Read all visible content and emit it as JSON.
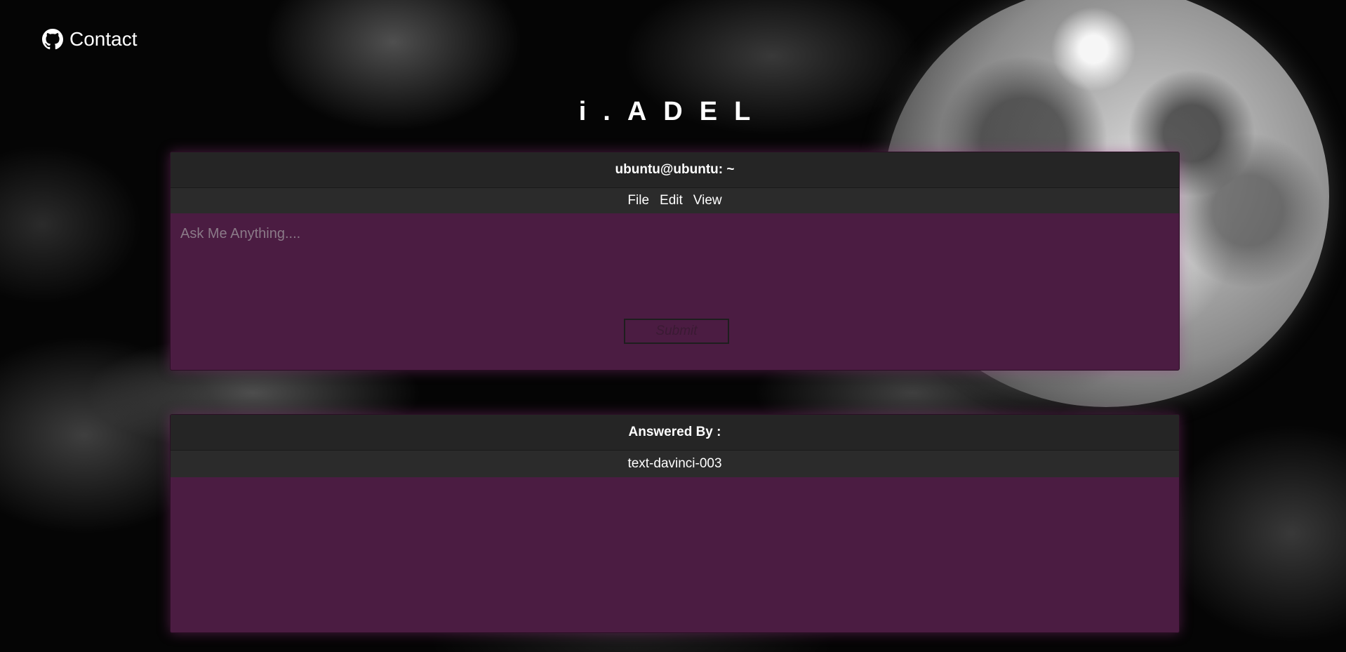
{
  "contact": {
    "label": "Contact",
    "icon": "github-icon"
  },
  "site": {
    "title": "i.ADEL"
  },
  "ask_panel": {
    "title": "ubuntu@ubuntu: ~",
    "menu": {
      "file": "File",
      "edit": "Edit",
      "view": "View"
    },
    "input_placeholder": "Ask Me Anything....",
    "submit_label": "Submit"
  },
  "answer_panel": {
    "title": "Answered By :",
    "model": "text-davinci-003",
    "answer": ""
  },
  "colors": {
    "panel_bg": "#4b1c42",
    "titlebar_bg": "#252525",
    "text": "#ffffff"
  }
}
